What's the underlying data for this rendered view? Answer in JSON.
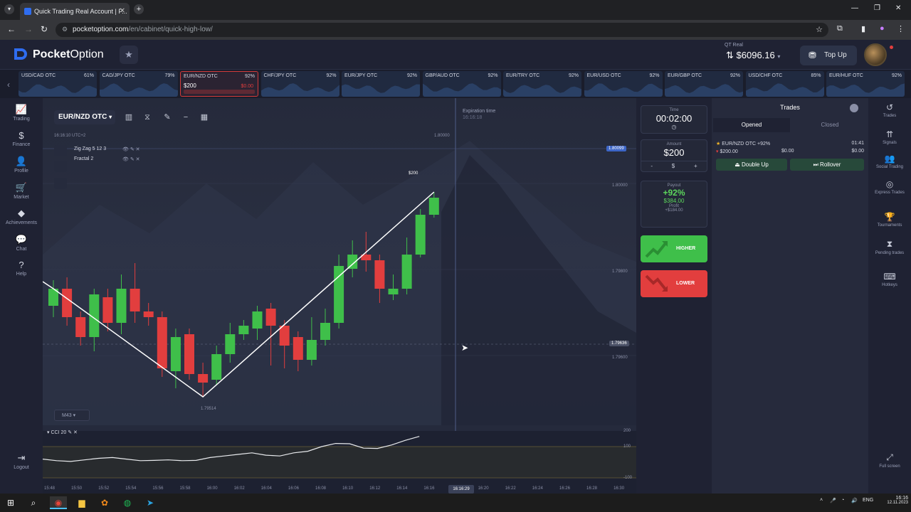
{
  "browser": {
    "tab_title": "Quick Trading Real Account | P...",
    "url_host": "pocketoption.com",
    "url_path": "/en/cabinet/quick-high-low/"
  },
  "header": {
    "brand_bold": "Pocket",
    "brand_light": "Option",
    "account_label": "QT Real",
    "balance": "$6096.16",
    "topup_label": "Top Up"
  },
  "assets": [
    {
      "name": "USD/CAD OTC",
      "pct": "61%"
    },
    {
      "name": "CAD/JPY OTC",
      "pct": "79%"
    },
    {
      "name": "EUR/NZD OTC",
      "pct": "92%",
      "amount": "$200",
      "amount_right": "$0.00",
      "active": true
    },
    {
      "name": "CHF/JPY OTC",
      "pct": "92%"
    },
    {
      "name": "EUR/JPY OTC",
      "pct": "92%"
    },
    {
      "name": "GBP/AUD OTC",
      "pct": "92%"
    },
    {
      "name": "EUR/TRY OTC",
      "pct": "92%"
    },
    {
      "name": "EUR/USD OTC",
      "pct": "92%"
    },
    {
      "name": "EUR/GBP OTC",
      "pct": "92%"
    },
    {
      "name": "USD/CHF OTC",
      "pct": "85%"
    },
    {
      "name": "EUR/HUF OTC",
      "pct": "92%"
    }
  ],
  "left_nav": [
    {
      "label": "Trading",
      "icon": "chart-icon"
    },
    {
      "label": "Finance",
      "icon": "dollar-icon"
    },
    {
      "label": "Profile",
      "icon": "user-icon"
    },
    {
      "label": "Market",
      "icon": "cart-icon"
    },
    {
      "label": "Achievements",
      "icon": "diamond-icon"
    },
    {
      "label": "Chat",
      "icon": "chat-icon"
    },
    {
      "label": "Help",
      "icon": "help-icon"
    },
    {
      "label": "Logout",
      "icon": "logout-icon"
    }
  ],
  "chart_toolbar": {
    "pair": "EUR/NZD OTC",
    "timezone": "16:16:10  UTC+2"
  },
  "indicators": [
    {
      "name": "Zig Zag 5 12 3"
    },
    {
      "name": "Fractal 2"
    }
  ],
  "expiration": {
    "label": "Expiration time",
    "value": "16:16:18"
  },
  "timeframe": "M43",
  "cci_label": "CCI 20",
  "price_labels": {
    "top_line": "1.80000",
    "current_tag": "1.80099",
    "p1": "1.80000",
    "p2": "1.79800",
    "mid_tag": "1.79636",
    "p3": "1.79600",
    "low_label": "1.79514",
    "trade_tag": "$200"
  },
  "cci_axis": [
    "200",
    "100",
    "-100"
  ],
  "time_axis": [
    "15:48",
    "15:50",
    "15:52",
    "15:54",
    "15:56",
    "15:58",
    "16:00",
    "16:02",
    "16:04",
    "16:06",
    "16:08",
    "16:10",
    "16:12",
    "16:14",
    "16:16",
    "16:20",
    "16:22",
    "16:24",
    "16:26",
    "16:28",
    "16:30"
  ],
  "time_now": "16:16:29",
  "trade_panel": {
    "time_label": "Time",
    "time_value": "00:02:00",
    "amount_label": "Amount",
    "amount_value": "$200",
    "minus": "-",
    "currency": "$",
    "plus": "+",
    "payout_label": "Payout",
    "payout_pct": "+92%",
    "payout_amount": "$384.00",
    "profit_label": "Profit",
    "profit_value": "+$184.00",
    "higher_label": "HIGHER",
    "lower_label": "LOWER"
  },
  "trades": {
    "title": "Trades",
    "tab_opened": "Opened",
    "tab_closed": "Closed",
    "item_pair": "EUR/NZD OTC +92%",
    "item_time": "01:41",
    "item_amount": "$200.00",
    "item_mid": "$0.00",
    "item_right": "$0.00",
    "double_up": "Double Up",
    "rollover": "Rollover"
  },
  "right_nav": [
    {
      "label": "Trades",
      "icon": "history-icon"
    },
    {
      "label": "Signals",
      "icon": "signal-icon"
    },
    {
      "label": "Social Trading",
      "icon": "users-icon"
    },
    {
      "label": "Express Trades",
      "icon": "express-icon"
    },
    {
      "label": "Tournaments",
      "icon": "trophy-icon"
    },
    {
      "label": "Pending trades",
      "icon": "hourglass-icon"
    },
    {
      "label": "Hotkeys",
      "icon": "keyboard-icon"
    },
    {
      "label": "Full screen",
      "icon": "fullscreen-icon"
    }
  ],
  "taskbar": {
    "lang": "ENG",
    "clock_time": "16:16",
    "clock_date": "12.11.2023"
  },
  "colors": {
    "up": "#3fbf4a",
    "down": "#e23e3e",
    "accent": "#3d66c7",
    "bg": "#1f2233"
  },
  "chart_data": {
    "type": "candlestick",
    "candles": [
      {
        "t": "15:48",
        "o": 1.7972,
        "c": 1.7978,
        "h": 1.7981,
        "l": 1.7968
      },
      {
        "t": "15:49",
        "o": 1.7978,
        "c": 1.7968,
        "h": 1.7982,
        "l": 1.7965
      },
      {
        "t": "15:50",
        "o": 1.7968,
        "c": 1.7961,
        "h": 1.797,
        "l": 1.7958
      },
      {
        "t": "15:51",
        "o": 1.7961,
        "c": 1.7976,
        "h": 1.7978,
        "l": 1.7956
      },
      {
        "t": "15:52",
        "o": 1.7975,
        "c": 1.7966,
        "h": 1.7978,
        "l": 1.7963
      },
      {
        "t": "15:53",
        "o": 1.7966,
        "c": 1.7978,
        "h": 1.7983,
        "l": 1.7962
      },
      {
        "t": "15:54",
        "o": 1.7978,
        "c": 1.797,
        "h": 1.7987,
        "l": 1.7966
      },
      {
        "t": "15:55",
        "o": 1.797,
        "c": 1.7968,
        "h": 1.7973,
        "l": 1.7965
      },
      {
        "t": "15:56",
        "o": 1.7968,
        "c": 1.795,
        "h": 1.797,
        "l": 1.7947
      },
      {
        "t": "15:57",
        "o": 1.7949,
        "c": 1.7961,
        "h": 1.7964,
        "l": 1.7943
      },
      {
        "t": "15:58",
        "o": 1.7962,
        "c": 1.7948,
        "h": 1.7964,
        "l": 1.7946
      },
      {
        "t": "15:59",
        "o": 1.7948,
        "c": 1.7945,
        "h": 1.7952,
        "l": 1.794
      },
      {
        "t": "16:00",
        "o": 1.7946,
        "c": 1.7955,
        "h": 1.7958,
        "l": 1.7944
      },
      {
        "t": "16:01",
        "o": 1.7955,
        "c": 1.7962,
        "h": 1.7966,
        "l": 1.7952
      },
      {
        "t": "16:02",
        "o": 1.7962,
        "c": 1.7965,
        "h": 1.7967,
        "l": 1.796
      },
      {
        "t": "16:03",
        "o": 1.7964,
        "c": 1.797,
        "h": 1.7972,
        "l": 1.796
      },
      {
        "t": "16:04",
        "o": 1.7971,
        "c": 1.7965,
        "h": 1.7973,
        "l": 1.7951
      },
      {
        "t": "16:05",
        "o": 1.7965,
        "c": 1.7958,
        "h": 1.7967,
        "l": 1.795
      },
      {
        "t": "16:06",
        "o": 1.7961,
        "c": 1.7953,
        "h": 1.7963,
        "l": 1.7949
      },
      {
        "t": "16:07",
        "o": 1.7953,
        "c": 1.796,
        "h": 1.7968,
        "l": 1.7951
      },
      {
        "t": "16:08",
        "o": 1.796,
        "c": 1.7966,
        "h": 1.7971,
        "l": 1.7958
      },
      {
        "t": "16:09",
        "o": 1.7966,
        "c": 1.7986,
        "h": 1.799,
        "l": 1.7964
      },
      {
        "t": "16:10",
        "o": 1.7985,
        "c": 1.799,
        "h": 1.7995,
        "l": 1.7982
      },
      {
        "t": "16:11",
        "o": 1.799,
        "c": 1.7988,
        "h": 1.7998,
        "l": 1.7984
      },
      {
        "t": "16:12",
        "o": 1.7988,
        "c": 1.7978,
        "h": 1.799,
        "l": 1.7973
      },
      {
        "t": "16:13",
        "o": 1.7976,
        "c": 1.7978,
        "h": 1.7983,
        "l": 1.7974
      },
      {
        "t": "16:14",
        "o": 1.7978,
        "c": 1.799,
        "h": 1.7996,
        "l": 1.7976
      },
      {
        "t": "16:15",
        "o": 1.799,
        "c": 1.8004,
        "h": 1.8006,
        "l": 1.7989
      },
      {
        "t": "16:16",
        "o": 1.8004,
        "c": 1.801,
        "h": 1.8012,
        "l": 1.8003
      }
    ],
    "zigzag": [
      {
        "t": "15:48",
        "p": 1.7978
      },
      {
        "t": "15:59",
        "p": 1.794
      },
      {
        "t": "16:16",
        "p": 1.8012
      }
    ],
    "cci": [
      20,
      10,
      5,
      15,
      25,
      30,
      20,
      10,
      12,
      15,
      10,
      12,
      30,
      40,
      50,
      60,
      45,
      40,
      60,
      70,
      100,
      120,
      118,
      90,
      88,
      110,
      140,
      165
    ],
    "ylim": [
      1.7935,
      1.803
    ]
  }
}
